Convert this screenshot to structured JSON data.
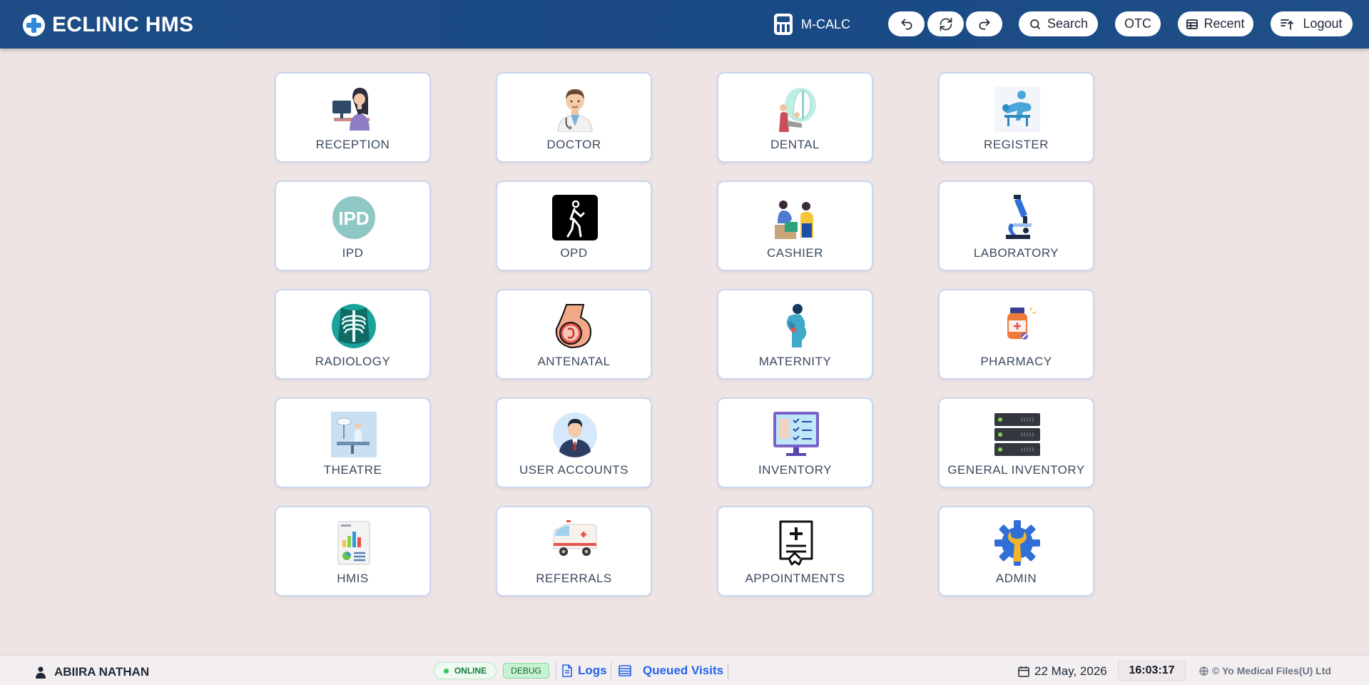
{
  "header": {
    "title": "ECLINIC HMS",
    "mcalc_label": "M-CALC",
    "search_label": "Search",
    "otc_label": "OTC",
    "recent_label": "Recent",
    "logout_label": "Logout"
  },
  "modules": [
    {
      "label": "RECEPTION",
      "icon": "reception-icon"
    },
    {
      "label": "DOCTOR",
      "icon": "doctor-icon"
    },
    {
      "label": "DENTAL",
      "icon": "dental-icon"
    },
    {
      "label": "REGISTER",
      "icon": "register-icon"
    },
    {
      "label": "IPD",
      "icon": "ipd-icon",
      "icon_text": "IPD"
    },
    {
      "label": "OPD",
      "icon": "opd-icon"
    },
    {
      "label": "CASHIER",
      "icon": "cashier-icon"
    },
    {
      "label": "LABORATORY",
      "icon": "microscope-icon"
    },
    {
      "label": "RADIOLOGY",
      "icon": "xray-icon"
    },
    {
      "label": "ANTENATAL",
      "icon": "antenatal-icon"
    },
    {
      "label": "MATERNITY",
      "icon": "maternity-icon"
    },
    {
      "label": "PHARMACY",
      "icon": "pharmacy-icon"
    },
    {
      "label": "THEATRE",
      "icon": "theatre-icon"
    },
    {
      "label": "USER ACCOUNTS",
      "icon": "user-accounts-icon"
    },
    {
      "label": "INVENTORY",
      "icon": "inventory-monitor-icon"
    },
    {
      "label": "GENERAL INVENTORY",
      "icon": "server-rack-icon"
    },
    {
      "label": "HMIS",
      "icon": "report-chart-icon"
    },
    {
      "label": "REFERRALS",
      "icon": "ambulance-icon"
    },
    {
      "label": "APPOINTMENTS",
      "icon": "appointment-certificate-icon"
    },
    {
      "label": "ADMIN",
      "icon": "gear-wrench-icon"
    }
  ],
  "footer": {
    "user_name": "ABIIRA NATHAN",
    "status": "ONLINE",
    "debug": "DEBUG",
    "logs_label": "Logs",
    "queued_label": "Queued Visits",
    "date": "22 May, 2026",
    "time": "16:03:17",
    "copyright": "© Yo Medical Files(U) Ltd"
  },
  "colors": {
    "header_bg": "#1d4c86",
    "page_bg": "#efe4e4",
    "tile_border": "#c9d6ee",
    "link": "#2563eb",
    "online": "#15803d"
  }
}
